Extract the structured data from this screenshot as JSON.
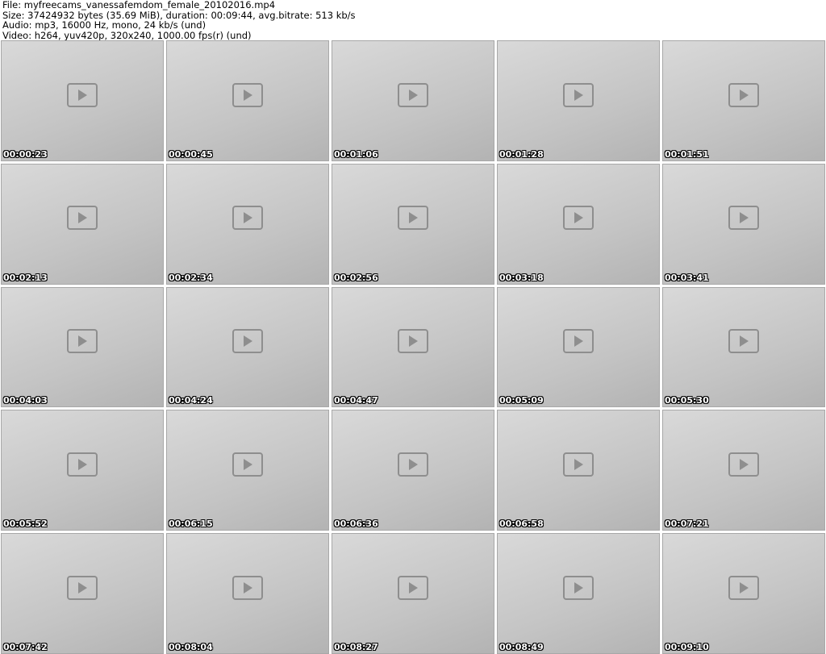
{
  "file_info": {
    "file": "File: myfreecams_vanessafemdom_female_20102016.mp4",
    "size": "Size: 37424932 bytes (35.69 MiB), duration: 00:09:44, avg.bitrate: 513 kb/s",
    "audio": "Audio: mp3, 16000 Hz, mono, 24 kb/s (und)",
    "video": "Video: h264, yuv420p, 320x240, 1000.00 fps(r) (und)"
  },
  "thumbnails": [
    {
      "timestamp": "00:00:23"
    },
    {
      "timestamp": "00:00:45"
    },
    {
      "timestamp": "00:01:06"
    },
    {
      "timestamp": "00:01:28"
    },
    {
      "timestamp": "00:01:51"
    },
    {
      "timestamp": "00:02:13"
    },
    {
      "timestamp": "00:02:34"
    },
    {
      "timestamp": "00:02:56"
    },
    {
      "timestamp": "00:03:18"
    },
    {
      "timestamp": "00:03:41"
    },
    {
      "timestamp": "00:04:03"
    },
    {
      "timestamp": "00:04:24"
    },
    {
      "timestamp": "00:04:47"
    },
    {
      "timestamp": "00:05:09"
    },
    {
      "timestamp": "00:05:30"
    },
    {
      "timestamp": "00:05:52"
    },
    {
      "timestamp": "00:06:15"
    },
    {
      "timestamp": "00:06:36"
    },
    {
      "timestamp": "00:06:58"
    },
    {
      "timestamp": "00:07:21"
    },
    {
      "timestamp": "00:07:42"
    },
    {
      "timestamp": "00:08:04"
    },
    {
      "timestamp": "00:08:27"
    },
    {
      "timestamp": "00:08:49"
    },
    {
      "timestamp": "00:09:10"
    }
  ]
}
